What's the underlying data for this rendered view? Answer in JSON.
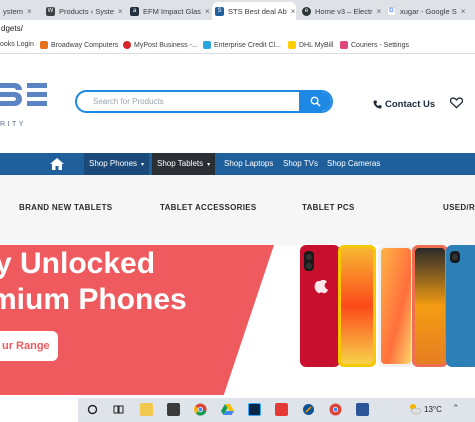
{
  "browser": {
    "tabs": [
      {
        "label": "ystem",
        "favicon": "white-square"
      },
      {
        "label": "Products ‹ Syste",
        "favicon": "wordpress-icon"
      },
      {
        "label": "EFM Impact Glas",
        "favicon": "amazon-icon"
      },
      {
        "label": "STS Best deal Ab",
        "favicon": "sts-icon",
        "active": true
      },
      {
        "label": "Home v3 – Electr",
        "favicon": "electro-icon"
      },
      {
        "label": "xugar - Google S",
        "favicon": "google-icon"
      }
    ],
    "close_glyph": "×",
    "url": "dgets/",
    "bookmarks": [
      {
        "label": "ooks Login"
      },
      {
        "label": "Broadway Computers"
      },
      {
        "label": "MyPost Business -..."
      },
      {
        "label": "Enterprise Credit Cl..."
      },
      {
        "label": "DHL MyBill"
      },
      {
        "label": "Couriers - Settings"
      }
    ]
  },
  "header": {
    "logo_sub": "RITY",
    "search_placeholder": "Search for Products",
    "contact_label": "Contact Us"
  },
  "nav": {
    "items": [
      {
        "label": "Shop Phones",
        "dropdown": true
      },
      {
        "label": "Shop Tablets",
        "dropdown": true
      },
      {
        "label": "Shop Laptops"
      },
      {
        "label": "Shop TVs"
      },
      {
        "label": "Shop Cameras"
      }
    ],
    "caret": "▾"
  },
  "categories": [
    {
      "label": "BRAND NEW TABLETS"
    },
    {
      "label": "TABLET ACCESSORIES"
    },
    {
      "label": "TABLET PCS"
    },
    {
      "label": "USED/R"
    }
  ],
  "hero": {
    "line1": "y Unlocked",
    "line2": "mium Phones",
    "cta": "ur Range"
  },
  "taskbar": {
    "temperature": "13°C",
    "icons": [
      "search-icon",
      "task-view-icon",
      "file-explorer-icon",
      "store-icon",
      "chrome-icon",
      "drive-icon",
      "photoshop-icon",
      "anydesk-icon",
      "snip-icon",
      "chrome-profile-icon",
      "word-icon"
    ]
  },
  "colors": {
    "accent_blue": "#1e88e5",
    "nav_blue": "#1f5f9c",
    "hero_red": "#ef5a5e"
  }
}
